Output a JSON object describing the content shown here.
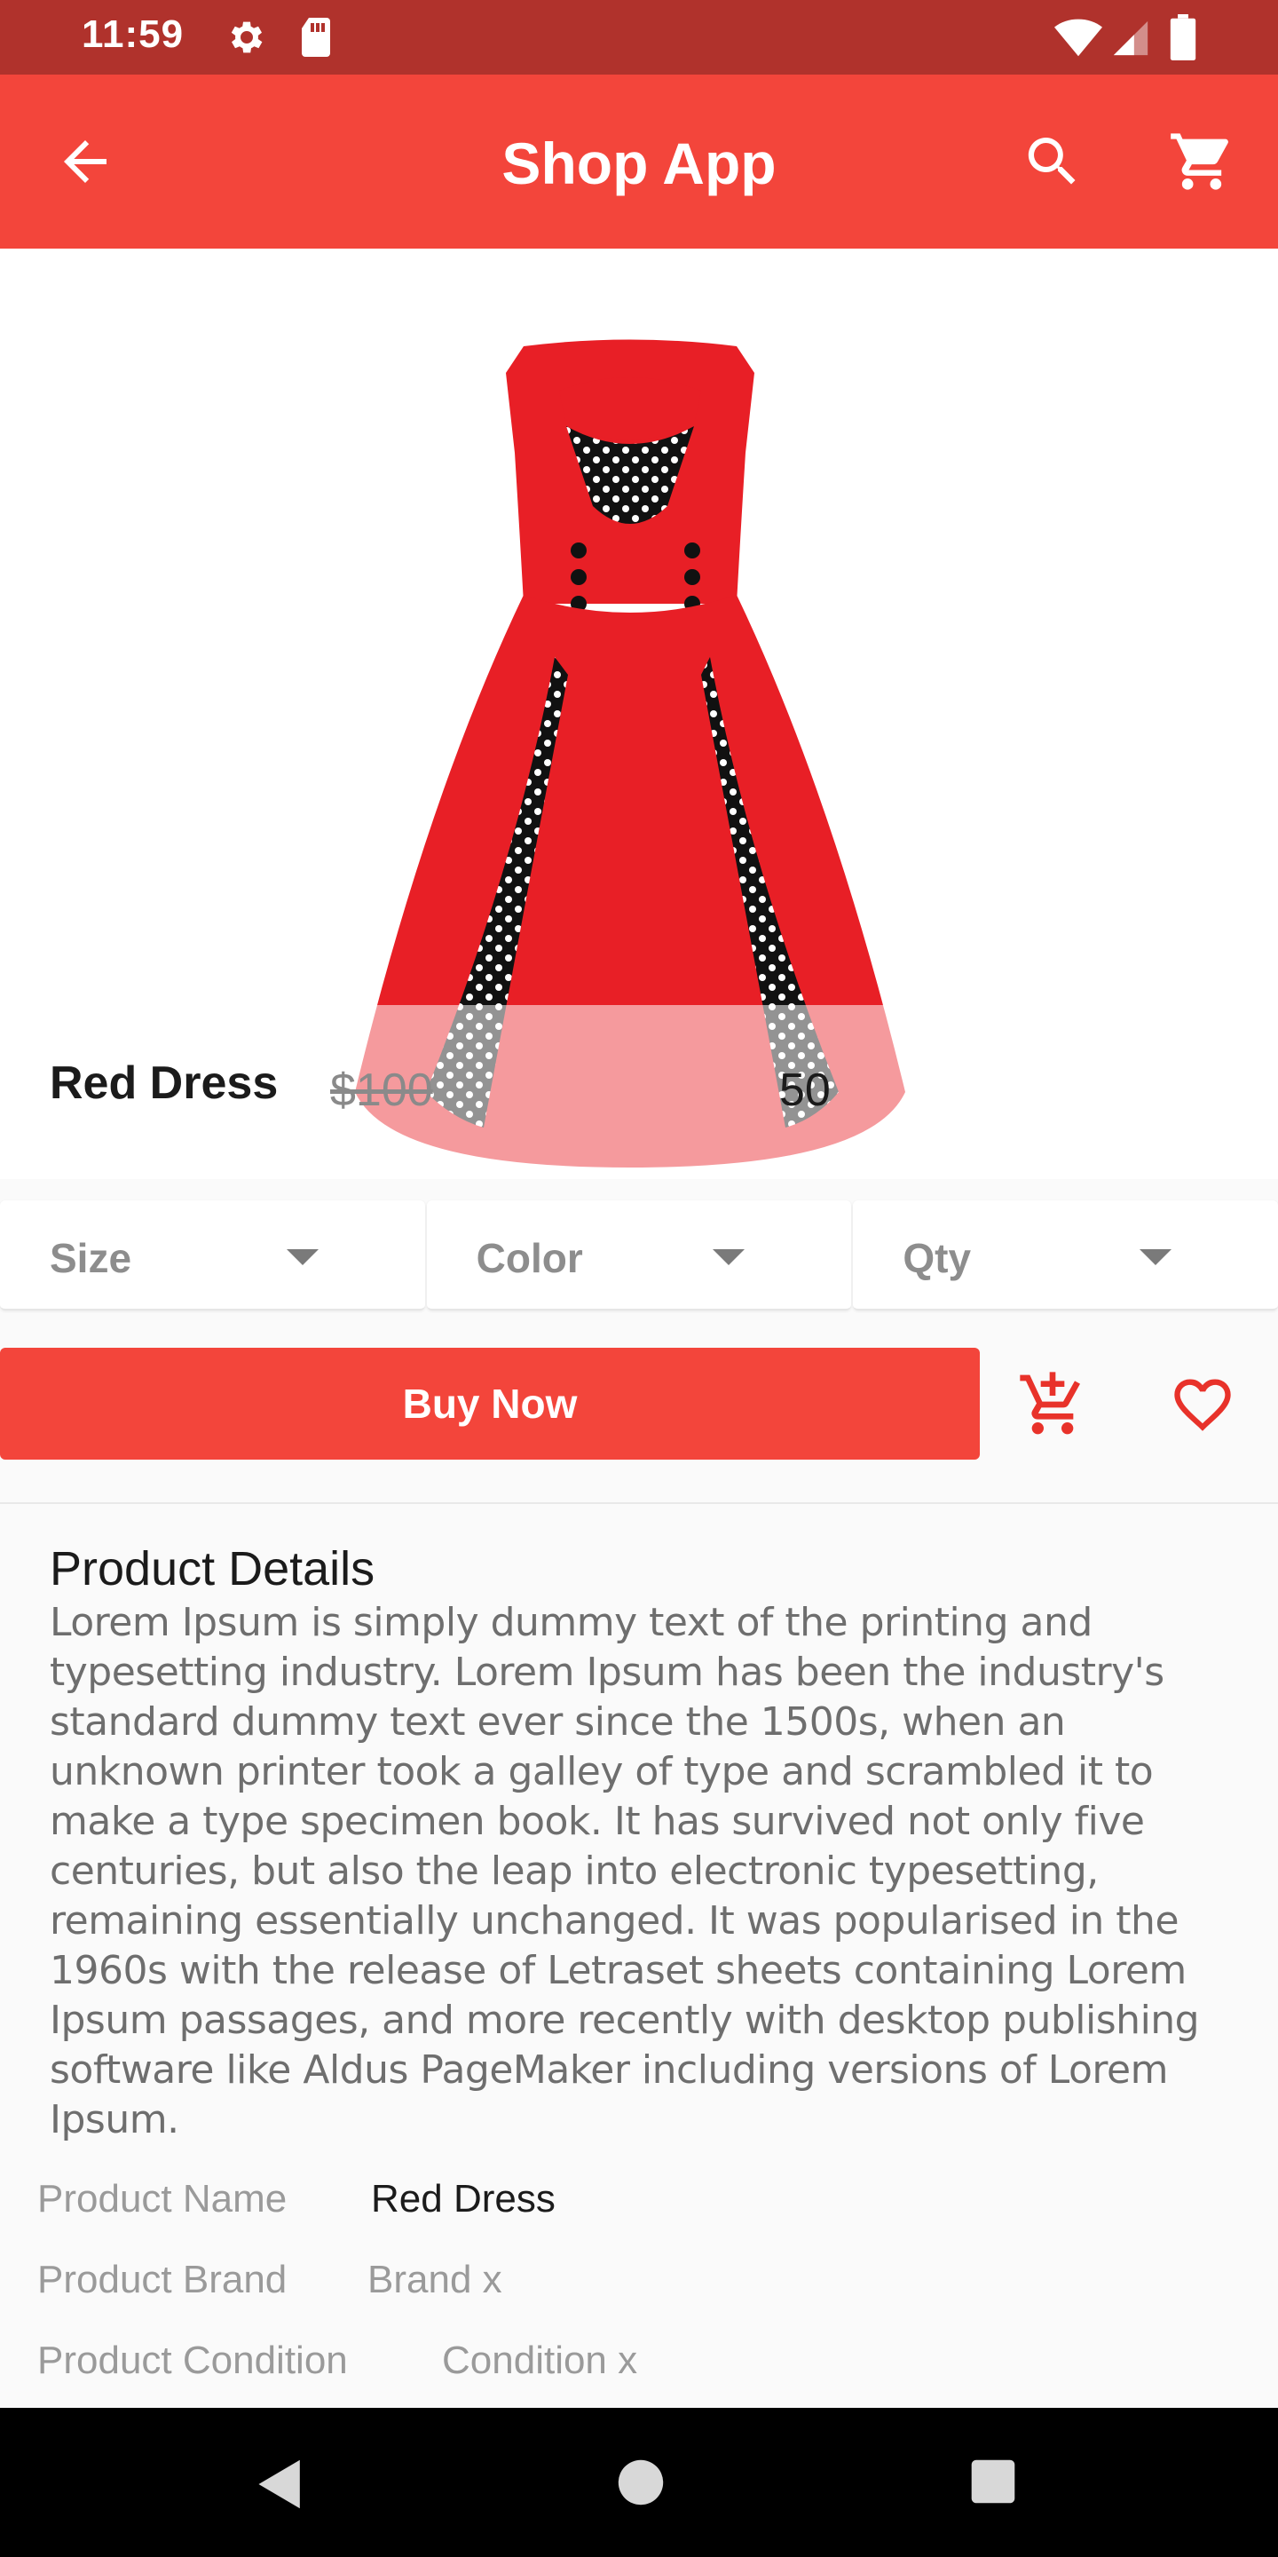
{
  "status_bar": {
    "time": "11:59",
    "icons": [
      "gear-icon",
      "sd-card-icon",
      "wifi-icon",
      "signal-icon",
      "battery-icon"
    ]
  },
  "app_bar": {
    "title": "Shop App",
    "icons": [
      "arrow-back-icon",
      "search-icon",
      "shopping-cart-icon"
    ],
    "color": "#f3453b"
  },
  "product": {
    "name": "Red Dress",
    "old_price": "$100",
    "new_price": "50",
    "image": "red-dress-image"
  },
  "options": [
    {
      "label": "Size"
    },
    {
      "label": "Color"
    },
    {
      "label": "Qty"
    }
  ],
  "actions": {
    "buy_now": "Buy Now",
    "icons": [
      "add-shopping-cart-icon",
      "favorite-border-icon"
    ]
  },
  "details": {
    "title": "Product Details",
    "description": "Lorem Ipsum is simply dummy text of the printing and typesetting industry. Lorem Ipsum has been the industry's standard dummy text ever since the 1500s, when an unknown printer took a galley of type and scrambled it to make a type specimen book. It has survived not only five centuries, but also the leap into electronic typesetting, remaining essentially unchanged. It was popularised in the 1960s with the release of Letraset sheets containing Lorem Ipsum passages, and more recently with desktop publishing software like Aldus PageMaker including versions of Lorem Ipsum.",
    "specs": [
      {
        "key": "Product Name",
        "value": "Red Dress"
      },
      {
        "key": "Product Brand",
        "value": "Brand x"
      },
      {
        "key": "Product Condition",
        "value": "Condition x"
      }
    ]
  },
  "nav_bar": {
    "icons": [
      "nav-back-icon",
      "nav-home-icon",
      "nav-recents-icon"
    ]
  }
}
